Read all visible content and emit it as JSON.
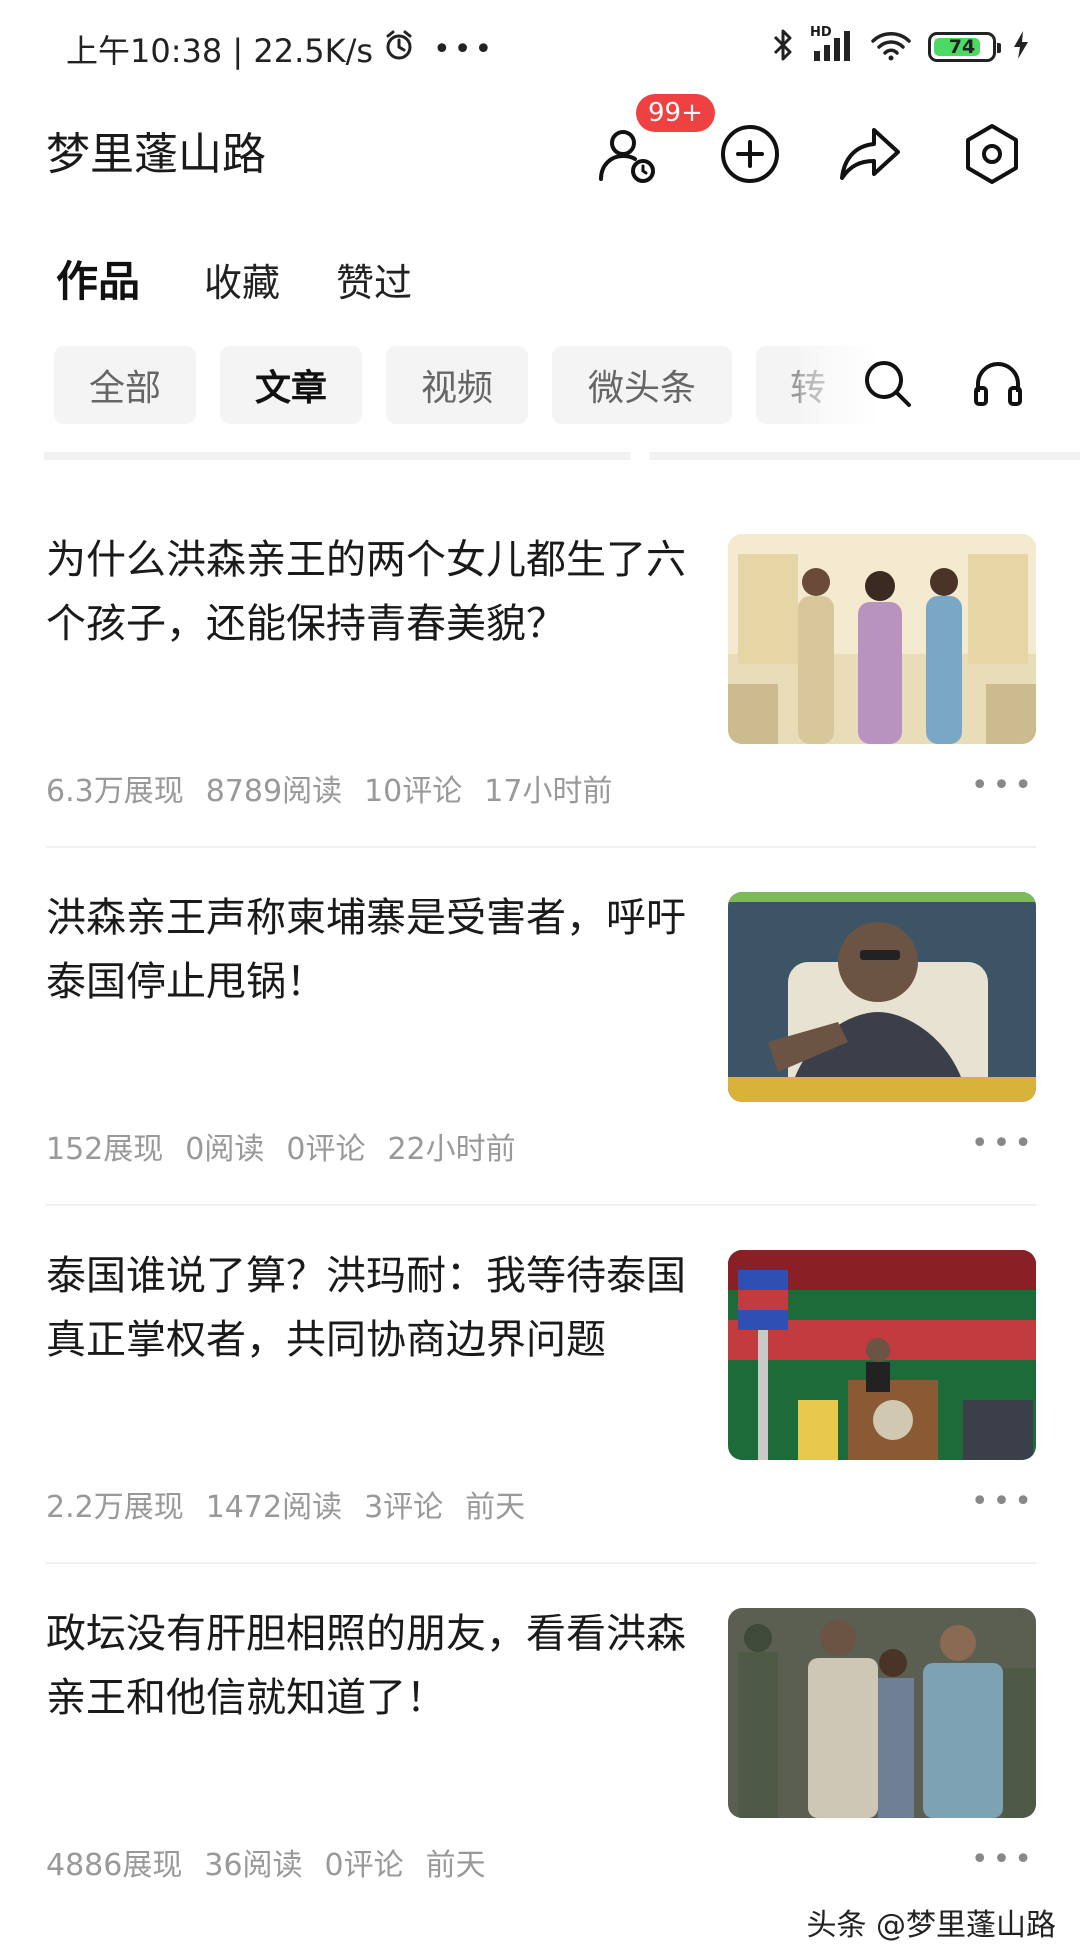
{
  "status_bar": {
    "time_speed": "上午10:38 | 22.5K/s",
    "more": "•••",
    "battery_level": "74",
    "network_label": "HD"
  },
  "header": {
    "title": "梦里蓬山路",
    "badge": "99+"
  },
  "main_tabs": [
    {
      "label": "作品",
      "active": true
    },
    {
      "label": "收藏",
      "active": false
    },
    {
      "label": "赞过",
      "active": false
    }
  ],
  "filters": [
    {
      "label": "全部",
      "active": false
    },
    {
      "label": "文章",
      "active": true
    },
    {
      "label": "视频",
      "active": false
    },
    {
      "label": "微头条",
      "active": false
    },
    {
      "label": "转",
      "active": false
    }
  ],
  "articles": [
    {
      "title": "为什么洪森亲王的两个女儿都生了六个孩子，还能保持青春美貌？",
      "impressions": "6.3万展现",
      "reads": "8789阅读",
      "comments": "10评论",
      "time": "17小时前",
      "thumb_colors": [
        "#d8c79a",
        "#b993c0",
        "#7aa7c6"
      ]
    },
    {
      "title": "洪森亲王声称柬埔寨是受害者，呼吁泰国停止甩锅！",
      "impressions": "152展现",
      "reads": "0阅读",
      "comments": "0评论",
      "time": "22小时前",
      "thumb_colors": [
        "#2f4a5e",
        "#6b5443",
        "#d9b23a"
      ]
    },
    {
      "title": "泰国谁说了算？洪玛耐：我等待泰国真正掌权者，共同协商边界问题",
      "impressions": "2.2万展现",
      "reads": "1472阅读",
      "comments": "3评论",
      "time": "前天",
      "thumb_colors": [
        "#1e6b3a",
        "#b3262e",
        "#e7c84a"
      ]
    },
    {
      "title": "政坛没有肝胆相照的朋友，看看洪森亲王和他信就知道了！",
      "impressions": "4886展现",
      "reads": "36阅读",
      "comments": "0评论",
      "time": "前天",
      "thumb_colors": [
        "#4e5a46",
        "#cfc7b5",
        "#7da2b4"
      ]
    }
  ],
  "more_label": "•••",
  "watermark": "头条 @梦里蓬山路"
}
